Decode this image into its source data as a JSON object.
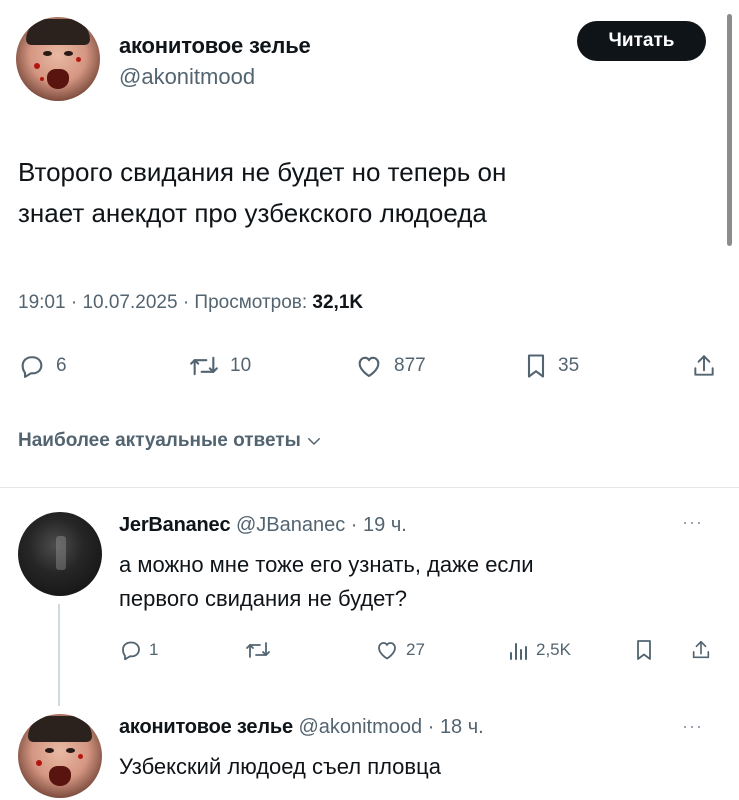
{
  "post": {
    "author_name": "аконитовое зелье",
    "author_handle": "@akonitmood",
    "read_button": "Читать",
    "text_line1": "Второго свидания не будет но теперь он",
    "text_line2": "знает анекдот про узбекского людоеда",
    "time": "19:01",
    "date": "10.07.2025",
    "views_label": "Просмотров:",
    "views_value": "32,1K",
    "replies": "6",
    "reposts": "10",
    "likes": "877",
    "bookmarks": "35"
  },
  "sort": {
    "label": "Наиболее актуальные ответы"
  },
  "reply1": {
    "author_name": "JerBananec",
    "author_handle": "@JBananec",
    "time_ago": "19 ч.",
    "text_line1": "а можно мне тоже его узнать, даже если",
    "text_line2": "первого свидания не будет?",
    "replies": "1",
    "likes": "27",
    "views": "2,5K",
    "more": "···"
  },
  "reply2": {
    "author_name": "аконитовое зелье",
    "author_handle": "@akonitmood",
    "time_ago": "18 ч.",
    "text_line1": "Узбекский людоед съел пловца",
    "more": "···"
  },
  "separator": "·",
  "icons": {
    "reply": "reply-icon",
    "repost": "repost-icon",
    "like": "heart-icon",
    "bookmark": "bookmark-icon",
    "share": "share-icon",
    "views": "views-icon",
    "chevron": "chevron-down-icon"
  }
}
